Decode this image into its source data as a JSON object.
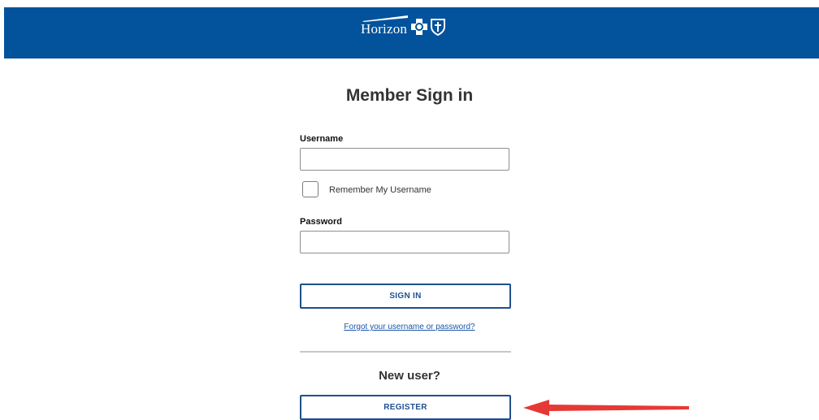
{
  "header": {
    "logo_text": "Horizon",
    "logo_color": "#02529c"
  },
  "main": {
    "title": "Member Sign in",
    "username_label": "Username",
    "username_value": "",
    "remember_label": "Remember My Username",
    "remember_checked": false,
    "password_label": "Password",
    "password_value": "",
    "signin_label": "SIGN IN",
    "forgot_link": "Forgot your username or password?",
    "new_user_heading": "New user?",
    "register_label": "REGISTER"
  },
  "colors": {
    "brand_blue": "#02529c",
    "button_border": "#1f4f8f",
    "link": "#1a56a8",
    "annotation_arrow": "#e53935"
  }
}
